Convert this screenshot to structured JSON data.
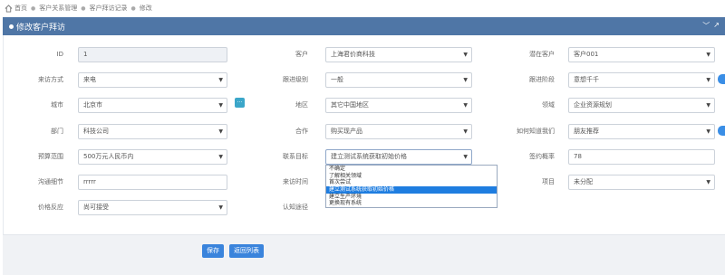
{
  "breadcrumb": {
    "items": [
      "首页",
      "客户关系管理",
      "客户拜访记录",
      "修改"
    ]
  },
  "panel": {
    "title": "修改客户拜访"
  },
  "form": {
    "id": {
      "label": "ID",
      "value": "1"
    },
    "customer": {
      "label": "客户",
      "value": "上海君价商科技"
    },
    "prospect": {
      "label": "潜在客户",
      "value": "客户001"
    },
    "visit_method": {
      "label": "来访方式",
      "value": "来电"
    },
    "follow_level": {
      "label": "跟进级别",
      "value": "一般"
    },
    "follow_stage": {
      "label": "跟进阶段",
      "value": "意想千千"
    },
    "city": {
      "label": "城市",
      "value": "北京市"
    },
    "area": {
      "label": "地区",
      "value": "其它中国地区"
    },
    "domain": {
      "label": "领域",
      "value": "企业资源规划"
    },
    "department": {
      "label": "部门",
      "value": "科技公司"
    },
    "cooperation": {
      "label": "合作",
      "value": "购买现产品"
    },
    "how_known": {
      "label": "如何知道我们",
      "value": "朋友推荐"
    },
    "budget": {
      "label": "预算范围",
      "value": "500万元人民币内"
    },
    "contact_goal": {
      "label": "联系目标",
      "value": "建立测试系统获取初始价格"
    },
    "sign_rate": {
      "label": "签约概率",
      "value": "78"
    },
    "comm_detail": {
      "label": "沟通细节",
      "value": "rrrrr"
    },
    "visit_time": {
      "label": "来访时间",
      "value": ""
    },
    "project": {
      "label": "项目",
      "value": "未分配"
    },
    "price_reaction": {
      "label": "价格反应",
      "value": "尚可接受"
    },
    "cognitive_path": {
      "label": "认知途径",
      "value": ""
    }
  },
  "dropdown_options": [
    "不确定",
    "了解相关领域",
    "首次尝试",
    "建立测试系统获取初始价格",
    "建立生产环境",
    "更换现有系统"
  ],
  "dropdown_selected": "建立测试系统获取初始价格",
  "buttons": {
    "save": "保存",
    "back": "返回列表"
  },
  "lookup_button": "...",
  "colors": {
    "header": "#4f76a6",
    "primary": "#3a84dc",
    "highlight": "#1e7de0"
  }
}
